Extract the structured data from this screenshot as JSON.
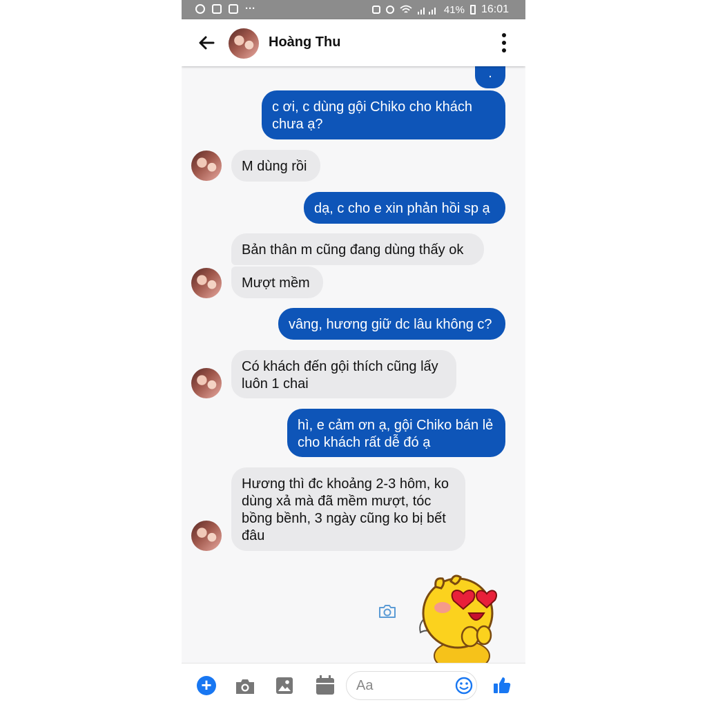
{
  "status_bar": {
    "battery": "41%",
    "time": "16:01",
    "overflow": "···"
  },
  "header": {
    "contact_name": "Hoàng Thu"
  },
  "messages": [
    {
      "from": "me",
      "text": "."
    },
    {
      "from": "me",
      "text": "c ơi, c dùng gội Chiko cho khách chưa ạ?"
    },
    {
      "from": "them",
      "text": "M dùng rồi"
    },
    {
      "from": "me",
      "text": "dạ, c cho e xin phản hồi sp ạ"
    },
    {
      "from": "them",
      "text": "Bản thân m cũng đang dùng thấy ok"
    },
    {
      "from": "them",
      "text": "Mượt mềm"
    },
    {
      "from": "me",
      "text": "vâng, hương giữ dc lâu không c?"
    },
    {
      "from": "them",
      "text": "Có khách đến gội thích cũng lấy luôn 1 chai"
    },
    {
      "from": "me",
      "text": "hì, e cảm ơn ạ, gội Chiko bán lẻ cho khách rất dễ đó ạ"
    },
    {
      "from": "them",
      "text": "Hương thì đc khoảng 2-3 hôm, ko dùng xả mà đã mềm mượt, tóc bồng bềnh, 3 ngày cũng ko bị bết đâu"
    }
  ],
  "composer": {
    "placeholder": "Aa"
  },
  "colors": {
    "outgoing_bubble": "#0e55b8",
    "incoming_bubble": "#e9e9eb",
    "accent": "#1877f2"
  },
  "icons": [
    "back-arrow-icon",
    "more-vert-icon",
    "camera-icon",
    "plus-icon",
    "image-icon",
    "calendar-icon",
    "smiley-icon",
    "thumbs-up-icon",
    "heart-eyes-sticker"
  ]
}
